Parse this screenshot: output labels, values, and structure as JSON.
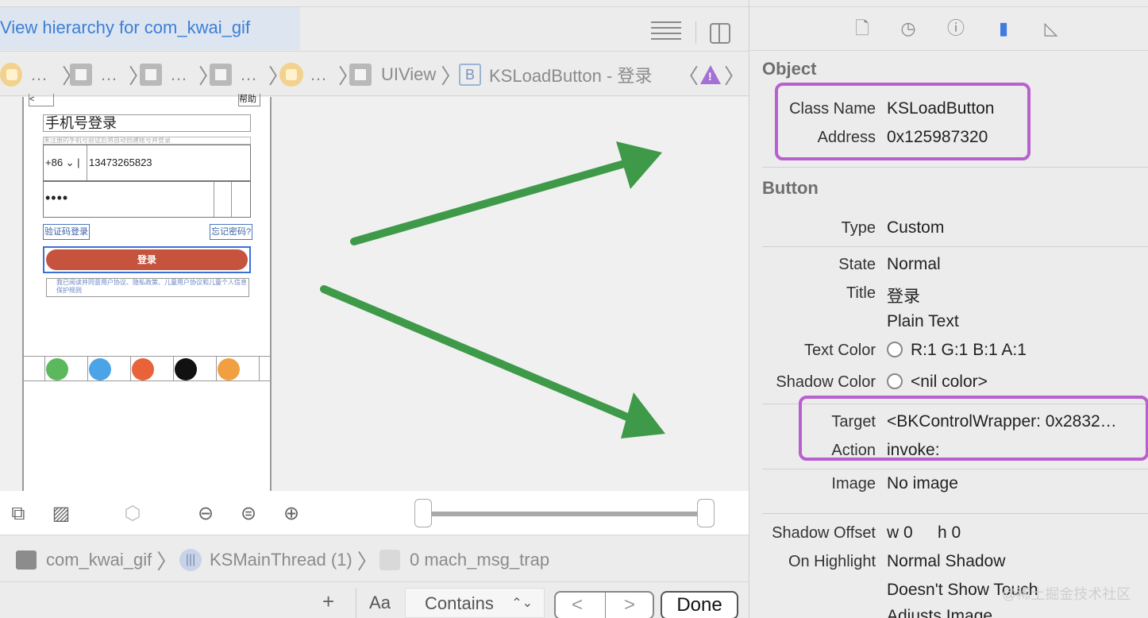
{
  "left": {
    "title": "View hierarchy for com_kwai_gif",
    "breadcrumbs": {
      "ellipsis": "…",
      "uiview": "UIView",
      "button_badge": "B",
      "current": "KSLoadButton - 登录"
    },
    "phone": {
      "help": "帮助",
      "back": "<",
      "title": "手机号登录",
      "hint": "未注册的手机号验证后将自动创建账号并登录",
      "country_code": "+86",
      "phone_number": "13473265823",
      "password_dots": "••••",
      "sms_login": "验证码登录",
      "forgot": "忘记密码?",
      "login": "登录",
      "agreement": "我已阅读并同意用户协议、隐私政策、儿童用户协议和儿童个人信息保护规则"
    },
    "debug": {
      "app": "com_kwai_gif",
      "thread": "KSMainThread (1)",
      "frame": "0 mach_msg_trap"
    },
    "filter": {
      "plus": "+",
      "aa": "Aa",
      "contains": "Contains",
      "updown": "⌃⌄",
      "prev": "<",
      "next": ">",
      "done": "Done"
    }
  },
  "inspector": {
    "object": {
      "header": "Object",
      "class_name_label": "Class Name",
      "class_name": "KSLoadButton",
      "address_label": "Address",
      "address": "0x125987320"
    },
    "button": {
      "header": "Button",
      "type_label": "Type",
      "type": "Custom",
      "state_label": "State",
      "state": "Normal",
      "title_label": "Title",
      "title": "登录",
      "title_kind": "Plain Text",
      "text_color_label": "Text Color",
      "text_color": "R:1 G:1 B:1 A:1",
      "shadow_color_label": "Shadow Color",
      "shadow_color": "<nil color>",
      "target_label": "Target",
      "target": "<BKControlWrapper: 0x2832…",
      "action_label": "Action",
      "action": "invoke:",
      "image_label": "Image",
      "image": "No image",
      "shadow_offset_label": "Shadow Offset",
      "shadow_offset_w": "w  0",
      "shadow_offset_h": "h  0",
      "on_highlight_label": "On Highlight",
      "on_highlight": "Normal Shadow",
      "highlight_touch": "Doesn't Show Touch",
      "adjusts_image": "Adjusts Image"
    }
  },
  "watermark": "@稀土掘金技术社区",
  "colors": {
    "highlight_box": "#b860cf",
    "arrow": "#3e9a48",
    "login_button": "#c5533e",
    "accent_blue": "#3f7be0"
  }
}
